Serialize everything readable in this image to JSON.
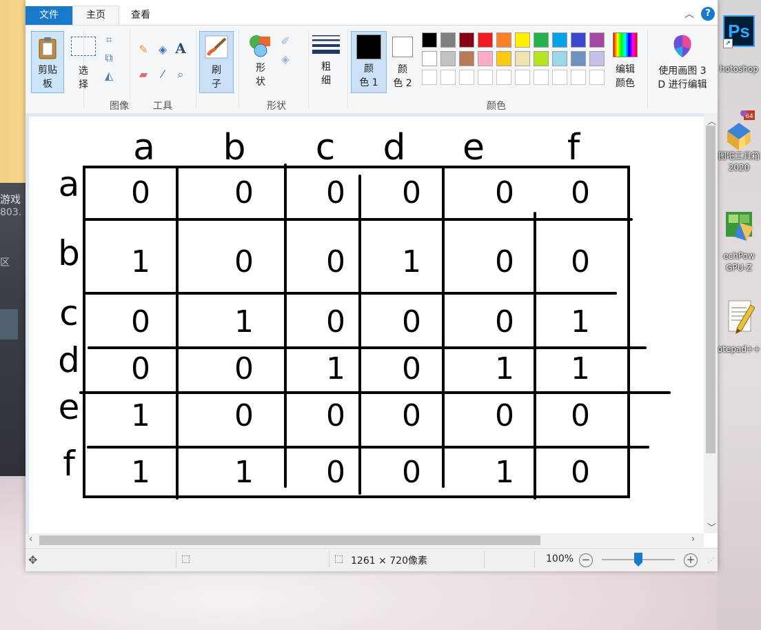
{
  "desktop": {
    "left_texts": [
      "游戏",
      "803.",
      "区"
    ],
    "icons": [
      {
        "name": "photoshop",
        "label": "hotoshop",
        "glyph": "Ps"
      },
      {
        "name": "toolbox",
        "label": "图吧工具箱 2020",
        "line1": "图吧工具箱",
        "line2": "2020"
      },
      {
        "name": "gpuz",
        "label": "echPow GPU-Z",
        "line1": "echPow",
        "line2": "GPU-Z"
      },
      {
        "name": "notepadpp",
        "label": "otepad++"
      }
    ]
  },
  "ribbon_tabs": {
    "file": "文件",
    "home": "主页",
    "view": "查看"
  },
  "ribbon": {
    "clipboard": {
      "paste_line1": "剪贴",
      "paste_line2": "板",
      "group": ""
    },
    "image": {
      "select_line1": "选",
      "select_line2": "择",
      "group": "图像"
    },
    "tools": {
      "group": "工具"
    },
    "brushes": {
      "line1": "刷",
      "line2": "子"
    },
    "shapes": {
      "line1": "形",
      "line2": "状",
      "group": "形状"
    },
    "size": {
      "line1": "粗",
      "line2": "细"
    },
    "colors": {
      "color1_line1": "颜",
      "color1_line2": "色 1",
      "color2_line1": "颜",
      "color2_line2": "色 2",
      "edit_line1": "编辑",
      "edit_line2": "颜色",
      "group": "颜色",
      "color1": "#000000",
      "color2": "#ffffff",
      "palette_row1": [
        "#000000",
        "#7f7f7f",
        "#880015",
        "#ed1c24",
        "#ff7f27",
        "#fff200",
        "#22b14c",
        "#00a2e8",
        "#3f48cc",
        "#a349a4"
      ],
      "palette_row2": [
        "#ffffff",
        "#c3c3c3",
        "#b97a57",
        "#ffaec9",
        "#ffc90e",
        "#efe4b0",
        "#b5e61d",
        "#99d9ea",
        "#7092be",
        "#c8bfe7"
      ]
    },
    "paint3d": {
      "line1": "使用画图 3",
      "line2": "D 进行编辑"
    }
  },
  "status": {
    "dimensions": "1261 × 720像素",
    "zoom": "100%"
  },
  "drawing": {
    "column_headers": [
      "a",
      "b",
      "c",
      "d",
      "e",
      "f"
    ],
    "row_headers": [
      "a",
      "b",
      "c",
      "d",
      "e",
      "f"
    ],
    "cells": [
      [
        "0",
        "0",
        "0",
        "0",
        "0",
        "0"
      ],
      [
        "1",
        "0",
        "0",
        "1",
        "0",
        "0"
      ],
      [
        "0",
        "1",
        "0",
        "0",
        "0",
        "1"
      ],
      [
        "0",
        "0",
        "1",
        "0",
        "1",
        "1"
      ],
      [
        "1",
        "0",
        "0",
        "0",
        "0",
        "0"
      ],
      [
        "1",
        "1",
        "0",
        "0",
        "1",
        "0"
      ]
    ]
  }
}
